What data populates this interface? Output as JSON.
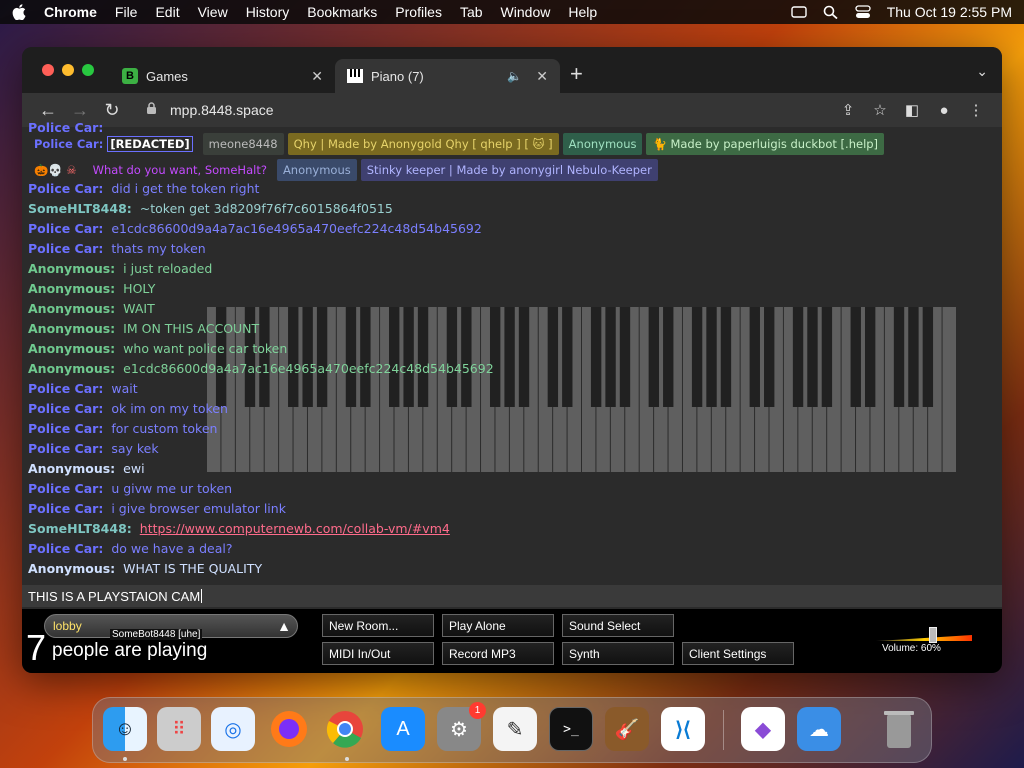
{
  "menubar": {
    "app": "Chrome",
    "items": [
      "File",
      "Edit",
      "View",
      "History",
      "Bookmarks",
      "Profiles",
      "Tab",
      "Window",
      "Help"
    ],
    "clock": "Thu Oct 19  2:55 PM"
  },
  "tabs": [
    {
      "label": "Games",
      "favicon_letter": "B"
    },
    {
      "label": "Piano (7)"
    }
  ],
  "url": "mpp.8448.space",
  "chat": {
    "tag_row1_first": "[REDACTED]",
    "tag_row1_partial": "meone8448",
    "tag_row1": [
      "Qhy | Made by Anonygold  Qhy [ qhelp ] [ 🐱 ]",
      "Anonymous",
      "🐈 Made by paperluigis  duckbot [.help]"
    ],
    "tag_row2": [
      "Anonymous",
      "Stinky keeper | Made by anonygirl  Nebulo-Keeper"
    ],
    "tag_row2_text": "What do you want, SomeHalt?",
    "messages": [
      {
        "name": "Police Car:",
        "text": "did i get the token right",
        "style": "pc"
      },
      {
        "name": "SomeHLT8448:",
        "text": "~token get 3d8209f76f7c6015864f0515",
        "style": "so"
      },
      {
        "name": "Police Car:",
        "text": "e1cdc86600d9a4a7ac16e4965a470eefc224c48d54b45692",
        "style": "pc"
      },
      {
        "name": "Police Car:",
        "text": "thats my token",
        "style": "pc"
      },
      {
        "name": "Anonymous:",
        "text": "i just reloaded",
        "style": "an"
      },
      {
        "name": "Anonymous:",
        "text": "HOLY",
        "style": "an"
      },
      {
        "name": "Anonymous:",
        "text": "WAIT",
        "style": "an"
      },
      {
        "name": "Anonymous:",
        "text": "IM ON THIS ACCOUNT",
        "style": "an"
      },
      {
        "name": "Anonymous:",
        "text": "who want police car token",
        "style": "an"
      },
      {
        "name": "Anonymous:",
        "text": "e1cdc86600d9a4a7ac16e4965a470eefc224c48d54b45692",
        "style": "an"
      },
      {
        "name": "Police Car:",
        "text": "wait",
        "style": "pc"
      },
      {
        "name": "Police Car:",
        "text": "ok im on my token",
        "style": "pc"
      },
      {
        "name": "Police Car:",
        "text": "for custom token",
        "style": "pc"
      },
      {
        "name": "Police Car:",
        "text": "say kek",
        "style": "pc"
      },
      {
        "name": "Anonymous:",
        "text": "ewi",
        "style": "an2"
      },
      {
        "name": "Police Car:",
        "text": "u givw me ur token",
        "style": "pc"
      },
      {
        "name": "Police Car:",
        "text": "i give browser emulator link",
        "style": "pc"
      },
      {
        "name": "SomeHLT8448:",
        "text": "https://www.computernewb.com/collab-vm/#vm4",
        "style": "so",
        "link": true
      },
      {
        "name": "Police Car:",
        "text": "do we have a deal?",
        "style": "pc"
      },
      {
        "name": "Anonymous:",
        "text": "WHAT IS THE QUALITY",
        "style": "an2"
      }
    ],
    "input_value": "THIS IS A PLAYSTAION CAM"
  },
  "bottom": {
    "room": "lobby",
    "room_bot": "SomeBot8448 [uhe]",
    "count": "7",
    "count_label": "people are playing",
    "buttons": {
      "new_room": "New Room...",
      "play_alone": "Play Alone",
      "sound_select": "Sound Select",
      "midi": "MIDI In/Out",
      "record": "Record MP3",
      "synth": "Synth",
      "client_settings": "Client Settings"
    },
    "volume_label": "Volume: 60%",
    "volume_level": 0.6
  },
  "dock": {
    "badge_settings": "1"
  }
}
